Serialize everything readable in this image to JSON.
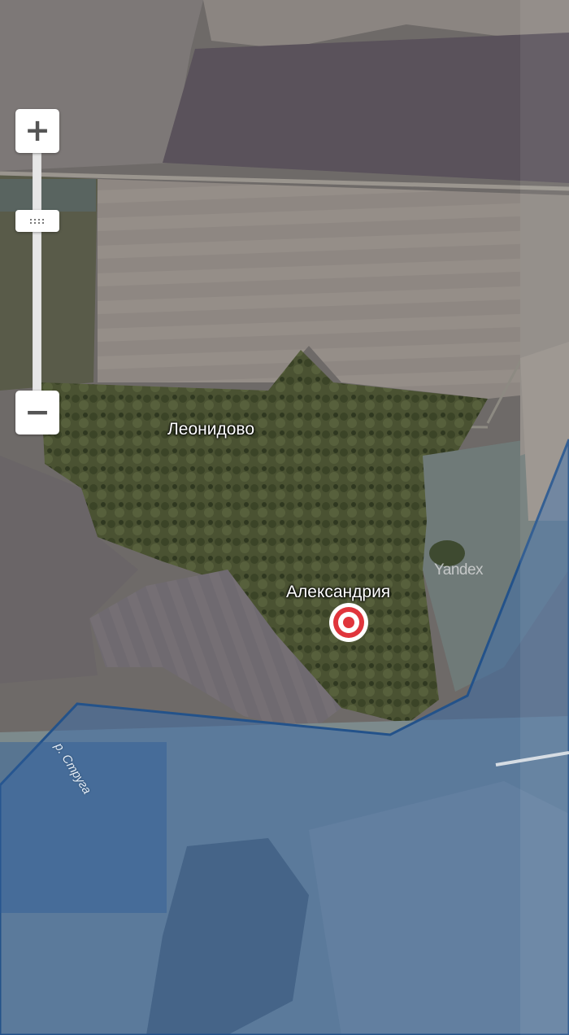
{
  "map": {
    "places": [
      {
        "name": "Леонидово"
      },
      {
        "name": "Александрия"
      }
    ],
    "river_label": "р. Струга",
    "watermark": "Yandex",
    "marker_icon": "target-marker-icon",
    "marker_color": "#e0353c",
    "region_fill_color": "#3f6da8",
    "region_border_color": "#23528a"
  },
  "controls": {
    "zoom_in_label": "+",
    "zoom_out_label": "−"
  }
}
